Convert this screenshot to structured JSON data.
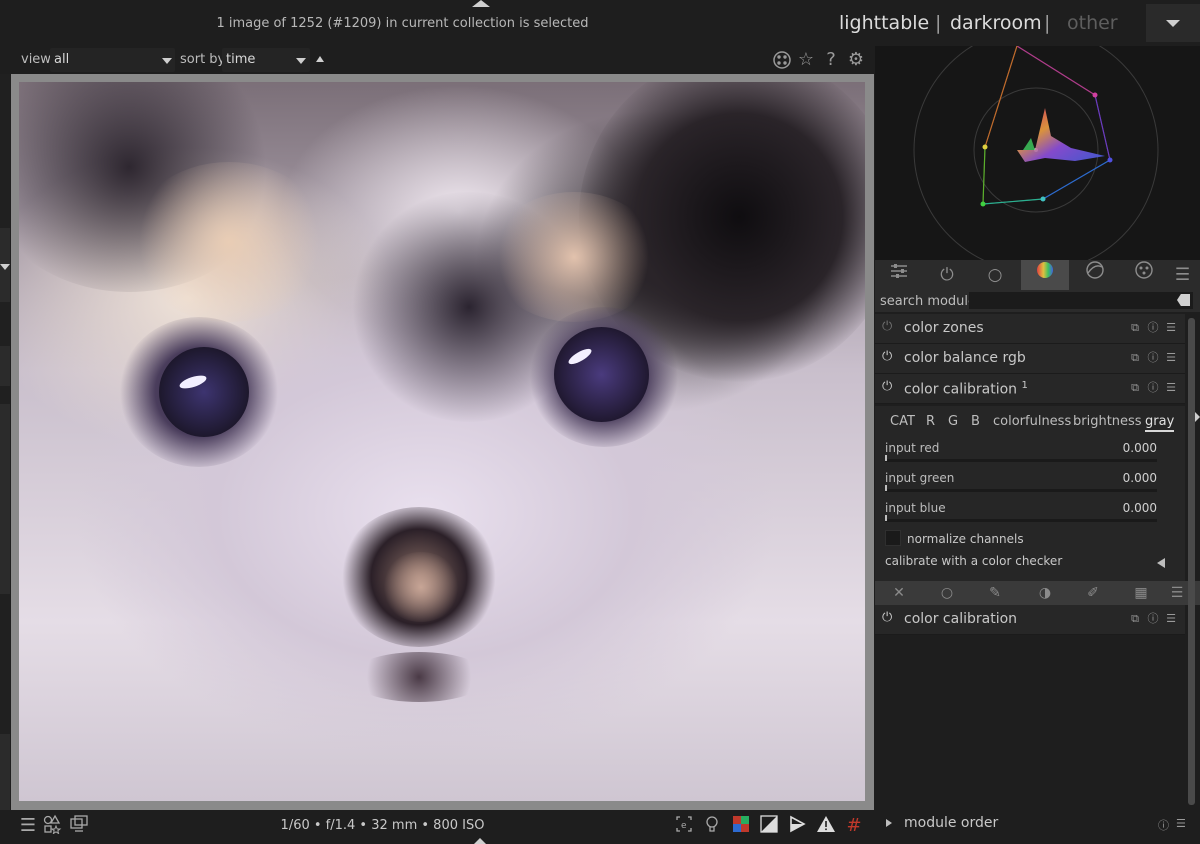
{
  "header": {
    "collection_status": "1 image of 1252 (#1209) in current collection is selected",
    "views": {
      "lighttable": "lighttable",
      "darkroom": "darkroom",
      "other": "other",
      "separator": "|"
    }
  },
  "filterbar": {
    "view_label": "view",
    "view_value": "all",
    "sort_label": "sort by",
    "sort_value": "time"
  },
  "top_icons": [
    "grouping-icon",
    "star-icon",
    "help-icon",
    "gear-icon"
  ],
  "bottombar": {
    "exif": "1/60 • f/1.4 • 32 mm • 800 ISO"
  },
  "right_panel": {
    "search_label": "search module",
    "search_value": "",
    "modules": [
      {
        "name": "color zones",
        "enabled": false
      },
      {
        "name": "color balance rgb",
        "enabled": true
      },
      {
        "name": "color calibration",
        "instance": "1",
        "enabled": true,
        "expanded": true
      },
      {
        "name": "color calibration",
        "enabled": true
      }
    ],
    "color_calibration": {
      "tabs": [
        "CAT",
        "R",
        "G",
        "B",
        "colorfulness",
        "brightness",
        "gray"
      ],
      "active_tab": "gray",
      "sliders": [
        {
          "label": "input red",
          "value": "0.000"
        },
        {
          "label": "input green",
          "value": "0.000"
        },
        {
          "label": "input blue",
          "value": "0.000"
        }
      ],
      "normalize_label": "normalize channels",
      "normalize_checked": false,
      "checker_label": "calibrate with a color checker"
    },
    "module_order_label": "module order"
  },
  "colors": {
    "background": "#1e1e1e",
    "panel": "#272727",
    "active_tab": "#4a4a4a",
    "text": "#c8c8c8"
  }
}
